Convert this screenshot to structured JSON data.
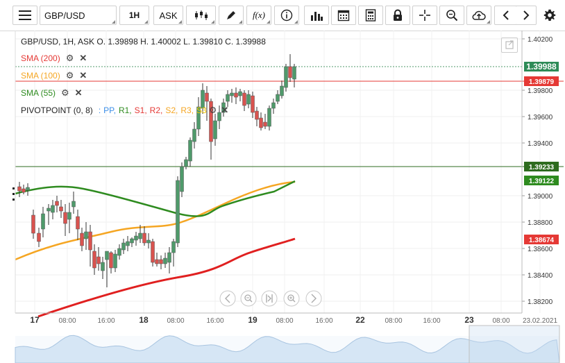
{
  "toolbar": {
    "symbol": "GBP/USD",
    "timeframe": "1H",
    "price_side": "ASK",
    "fx_label": "f(x)"
  },
  "header": {
    "ohlc": "GBP/USD, 1H, ASK   O. 1.39898 H. 1.40002 L. 1.39810 C. 1.39988"
  },
  "indicators": {
    "sma200": {
      "label": "SMA (200)",
      "color": "#e53935"
    },
    "sma100": {
      "label": "SMA (100)",
      "color": "#f5a623"
    },
    "sma55": {
      "label": "SMA (55)",
      "color": "#2e8b1f"
    },
    "pivot": {
      "label": "PIVOTPOINT (0, 8)",
      "sep": ":",
      "items": [
        {
          "text": "PP,",
          "color": "#3b8ee8"
        },
        {
          "text": "R1,",
          "color": "#2e8b1f"
        },
        {
          "text": "S1,",
          "color": "#e53935"
        },
        {
          "text": "R2,",
          "color": "#e53935"
        },
        {
          "text": "S2,",
          "color": "#f5a623"
        },
        {
          "text": "R3,",
          "color": "#f5a623"
        },
        {
          "text": "S3",
          "color": "#f5c800"
        }
      ]
    }
  },
  "price_axis": {
    "ticks": [
      "1.40200",
      "1.39800",
      "1.39600",
      "1.39400",
      "1.39000",
      "1.38800",
      "1.38600",
      "1.38400",
      "1.38200"
    ],
    "badges": [
      {
        "label": "1.39988",
        "color": "#2e8b57"
      },
      {
        "label": "1.39879",
        "color": "#e53935"
      },
      {
        "label": "1.39233",
        "color": "#2e6b1f"
      },
      {
        "label": "1.39122",
        "color": "#2e8b1f"
      },
      {
        "label": "1.38674",
        "color": "#e53935"
      }
    ]
  },
  "time_axis": {
    "labels": [
      "17",
      "08:00",
      "16:00",
      "18",
      "08:00",
      "16:00",
      "19",
      "08:00",
      "16:00",
      "22",
      "08:00",
      "16:00",
      "23",
      "08:00",
      "23.02.2021"
    ]
  },
  "colors": {
    "up": "#4f9a6b",
    "down": "#d9534f",
    "grid": "#eeeeee"
  }
}
